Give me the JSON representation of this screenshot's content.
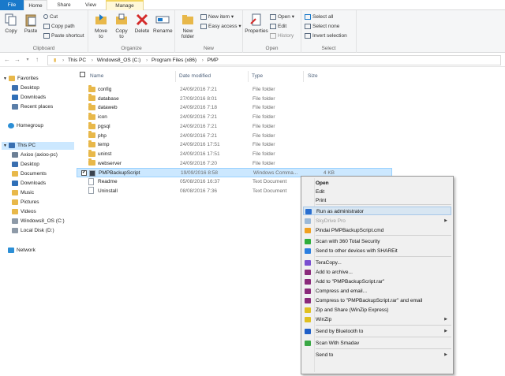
{
  "ribbon": {
    "tabs": [
      "File",
      "Home",
      "Share",
      "View",
      "Manage"
    ],
    "clipboard": {
      "label": "Clipboard",
      "copy": "Copy",
      "paste": "Paste",
      "cut": "Cut",
      "copy_path": "Copy path",
      "paste_shortcut": "Paste shortcut"
    },
    "organize": {
      "label": "Organize",
      "move_to": "Move to",
      "move_to_l1": "Move",
      "move_to_l2": "to",
      "copy_to_l1": "Copy",
      "copy_to_l2": "to",
      "delete": "Delete",
      "rename": "Rename"
    },
    "new": {
      "label": "New",
      "new_folder_l1": "New",
      "new_folder_l2": "folder",
      "new_item": "New item",
      "easy_access": "Easy access"
    },
    "open": {
      "label": "Open",
      "properties": "Properties",
      "open": "Open",
      "edit": "Edit",
      "history": "History"
    },
    "select": {
      "label": "Select",
      "select_all": "Select all",
      "select_none": "Select none",
      "invert": "Invert selection"
    }
  },
  "address": {
    "crumbs": [
      "This PC",
      "Windows8_OS (C:)",
      "Program Files (x86)",
      "PMP"
    ]
  },
  "nav": {
    "favorites": "Favorites",
    "fav_items": [
      "Desktop",
      "Downloads",
      "Recent places"
    ],
    "homegroup": "Homegroup",
    "this_pc": "This PC",
    "pc_items": [
      "Axioo (axioo-pc)",
      "Desktop",
      "Documents",
      "Downloads",
      "Music",
      "Pictures",
      "Videos",
      "Windows8_OS (C:)",
      "Local Disk (D:)"
    ],
    "network": "Network"
  },
  "columns": {
    "name": "Name",
    "date": "Date modified",
    "type": "Type",
    "size": "Size"
  },
  "files": [
    {
      "name": "config",
      "date": "24/09/2016 7:21",
      "type": "File folder",
      "size": "",
      "kind": "folder"
    },
    {
      "name": "database",
      "date": "27/09/2016 8:01",
      "type": "File folder",
      "size": "",
      "kind": "folder"
    },
    {
      "name": "dataweb",
      "date": "24/09/2016 7:18",
      "type": "File folder",
      "size": "",
      "kind": "folder"
    },
    {
      "name": "icon",
      "date": "24/09/2016 7:21",
      "type": "File folder",
      "size": "",
      "kind": "folder"
    },
    {
      "name": "pgsql",
      "date": "24/09/2016 7:21",
      "type": "File folder",
      "size": "",
      "kind": "folder"
    },
    {
      "name": "php",
      "date": "24/09/2016 7:21",
      "type": "File folder",
      "size": "",
      "kind": "folder"
    },
    {
      "name": "temp",
      "date": "24/09/2016 17:51",
      "type": "File folder",
      "size": "",
      "kind": "folder"
    },
    {
      "name": "uninst",
      "date": "24/09/2016 17:51",
      "type": "File folder",
      "size": "",
      "kind": "folder"
    },
    {
      "name": "webserver",
      "date": "24/09/2016 7:20",
      "type": "File folder",
      "size": "",
      "kind": "folder"
    },
    {
      "name": "PMPBackupScript",
      "date": "19/09/2016 8:58",
      "type": "Windows Comma...",
      "size": "4 KB",
      "kind": "cmd"
    },
    {
      "name": "Readme",
      "date": "05/08/2016 16:37",
      "type": "Text Document",
      "size": "",
      "kind": "txt"
    },
    {
      "name": "Uninstall",
      "date": "08/08/2016 7:36",
      "type": "Text Document",
      "size": "",
      "kind": "txt"
    }
  ],
  "context_menu": {
    "items": [
      {
        "label": "Open",
        "bold": true
      },
      {
        "label": "Edit"
      },
      {
        "label": "Print"
      },
      {
        "label": "Run as administrator",
        "highlight": true,
        "icon": "shield-icon"
      },
      {
        "label": "SkyDrive Pro",
        "submenu": true,
        "disabled": true,
        "icon": "skydrive-icon"
      },
      {
        "label": "Pindai PMPBackupScript.cmd",
        "icon": "smadav-icon"
      },
      {
        "label": "Scan with 360 Total Security",
        "icon": "360-icon"
      },
      {
        "label": "Send to other devices with SHAREit",
        "icon": "shareit-icon"
      },
      {
        "label": "TeraCopy...",
        "icon": "teracopy-icon"
      },
      {
        "label": "Add to archive...",
        "icon": "winrar-icon"
      },
      {
        "label": "Add to \"PMPBackupScript.rar\"",
        "icon": "winrar-icon"
      },
      {
        "label": "Compress and email...",
        "icon": "winrar-icon"
      },
      {
        "label": "Compress to \"PMPBackupScript.rar\" and email",
        "icon": "winrar-icon"
      },
      {
        "label": "Zip and Share (WinZip Express)",
        "icon": "winzip-icon"
      },
      {
        "label": "WinZip",
        "submenu": true,
        "icon": "winzip-icon"
      },
      {
        "label": "Send by Bluetooth to",
        "submenu": true,
        "icon": "bluetooth-icon"
      },
      {
        "label": "Scan With Smadav",
        "icon": "smadav-scan-icon"
      },
      {
        "label": "Send to",
        "submenu": true
      }
    ]
  },
  "colors": {
    "accent": "#1979ca",
    "selection": "#cce8ff",
    "folder": "#e8b84a"
  }
}
